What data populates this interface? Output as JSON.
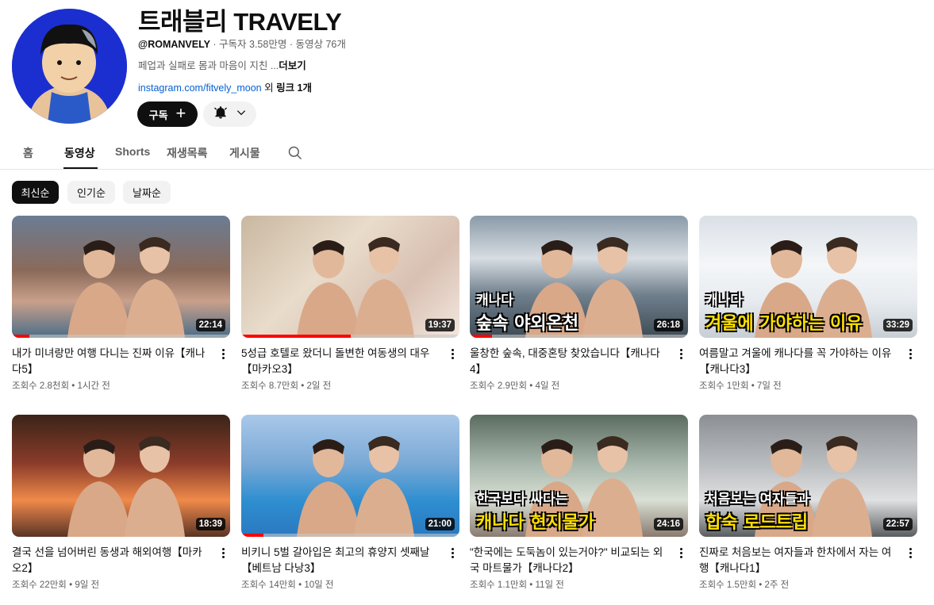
{
  "channel": {
    "name": "트래블리 TRAVELY",
    "handle": "@ROMANVELY",
    "subscribers": "구독자 3.58만명",
    "video_count": "동영상 76개",
    "description": "페업과 실패로 몸과 마음이 지친 ...",
    "more_label": "더보기",
    "link": "instagram.com/fitvely_moon",
    "link_suffix_pre": " 외 ",
    "link_suffix": "링크 1개",
    "subscribe_label": "구독"
  },
  "tabs": [
    "홈",
    "동영상",
    "Shorts",
    "재생목록",
    "게시물"
  ],
  "chips": [
    "최신순",
    "인기순",
    "날짜순"
  ],
  "videos": [
    {
      "title": "내가 미녀랑만 여행 다니는 진짜 이유【캐나다5】",
      "views": "조회수 2.8천회",
      "age": "1시간 전",
      "duration": "22:14",
      "progress": 0.08,
      "overlay_top": "",
      "overlay_main": ""
    },
    {
      "title": "5성급 호텔로 왔더니 돌변한 여동생의 대우【마카오3】",
      "views": "조회수 8.7만회",
      "age": "2일 전",
      "duration": "19:37",
      "progress": 0.5,
      "overlay_top": "",
      "overlay_main": ""
    },
    {
      "title": "울창한 숲속, 대중혼탕 찾았습니다【캐나다4】",
      "views": "조회수 2.9만회",
      "age": "4일 전",
      "duration": "26:18",
      "progress": 0.1,
      "overlay_top": "캐나다",
      "overlay_main": "숲속 야외온천"
    },
    {
      "title": "여름말고 겨울에 캐나다를 꼭 가야하는 이유【캐나다3】",
      "views": "조회수 1만회",
      "age": "7일 전",
      "duration": "33:29",
      "progress": 0,
      "overlay_top": "캐나다",
      "overlay_main": "겨울에 가야하는 이유"
    },
    {
      "title": "결국 선을 넘어버린 동생과 해외여행【마카오2】",
      "views": "조회수 22만회",
      "age": "9일 전",
      "duration": "18:39",
      "progress": 0,
      "overlay_top": "",
      "overlay_main": ""
    },
    {
      "title": "비키니 5벌 갈아입은 최고의 휴양지 셋째날【베트남 다낭3】",
      "views": "조회수 14만회",
      "age": "10일 전",
      "duration": "21:00",
      "progress": 0.1,
      "overlay_top": "",
      "overlay_main": ""
    },
    {
      "title": "\"한국에는 도둑놈이 있는거야?\" 비교되는 외국 마트물가【캐나다2】",
      "views": "조회수 1.1만회",
      "age": "11일 전",
      "duration": "24:16",
      "progress": 0,
      "overlay_top": "한국보다 싸다는",
      "overlay_main": "캐나다 현지물가"
    },
    {
      "title": "진짜로 처음보는 여자들과 한차에서 자는 여행【캐나다1】",
      "views": "조회수 1.5만회",
      "age": "2주 전",
      "duration": "22:57",
      "progress": 0,
      "overlay_top": "처음보는 여자들과",
      "overlay_main": "합숙 로드트립"
    }
  ],
  "colors": {
    "accent": "#ff0000",
    "avatar_bg": "#1b2fd0",
    "overlay_yellow": "#ffe000"
  }
}
